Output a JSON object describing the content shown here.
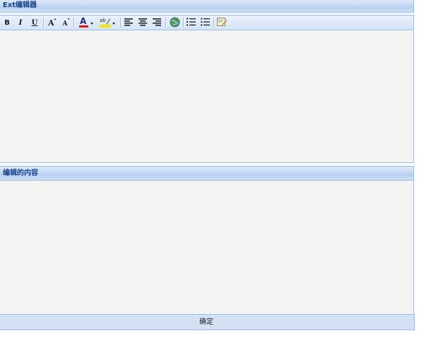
{
  "editor_panel": {
    "title": "Ext编辑器",
    "toolbar": {
      "bold_label": "B",
      "italic_label": "I",
      "underline_label": "U",
      "font_increase_icon": "font-size-increase-icon",
      "font_decrease_icon": "font-size-decrease-icon",
      "font_color_icon": "font-color-icon",
      "highlight_icon": "highlight-color-icon",
      "align_left_icon": "align-left-icon",
      "align_center_icon": "align-center-icon",
      "align_right_icon": "align-right-icon",
      "link_icon": "create-link-icon",
      "ordered_list_icon": "ordered-list-icon",
      "unordered_list_icon": "unordered-list-icon",
      "source_edit_icon": "source-edit-icon"
    },
    "content": ""
  },
  "content_panel": {
    "title": "编辑的内容",
    "content": ""
  },
  "footer": {
    "confirm_label": "确定"
  },
  "colors": {
    "header_text": "#15428b",
    "border": "#99bbe8",
    "body_bg": "#f3f4f2",
    "font_color_bar": "#e00000",
    "highlight_bar": "#f5e300"
  }
}
